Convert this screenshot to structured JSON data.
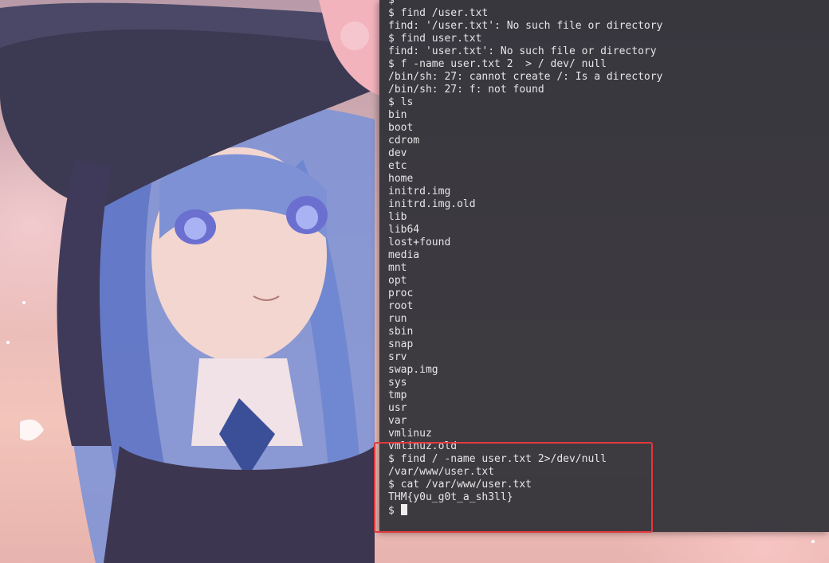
{
  "terminal": {
    "lines": [
      "$",
      "$ find /user.txt",
      "find: '/user.txt': No such file or directory",
      "$ find user.txt",
      "find: 'user.txt': No such file or directory",
      "$ f -name user.txt 2  > / dev/ null",
      "/bin/sh: 27: cannot create /: Is a directory",
      "/bin/sh: 27: f: not found",
      "$ ls",
      "bin",
      "boot",
      "cdrom",
      "dev",
      "etc",
      "home",
      "initrd.img",
      "initrd.img.old",
      "lib",
      "lib64",
      "lost+found",
      "media",
      "mnt",
      "opt",
      "proc",
      "root",
      "run",
      "sbin",
      "snap",
      "srv",
      "swap.img",
      "sys",
      "tmp",
      "usr",
      "var",
      "vmlinuz",
      "vmlinuz.old",
      "$ find / -name user.txt 2>/dev/null",
      "/var/www/user.txt",
      "$ cat /var/www/user.txt",
      "THM{y0u_g0t_a_sh3ll}"
    ],
    "prompt": "$ "
  },
  "colors": {
    "terminal_bg": "#2b2d34",
    "terminal_text": "#e6e6e6",
    "highlight_border": "#e2383e"
  }
}
